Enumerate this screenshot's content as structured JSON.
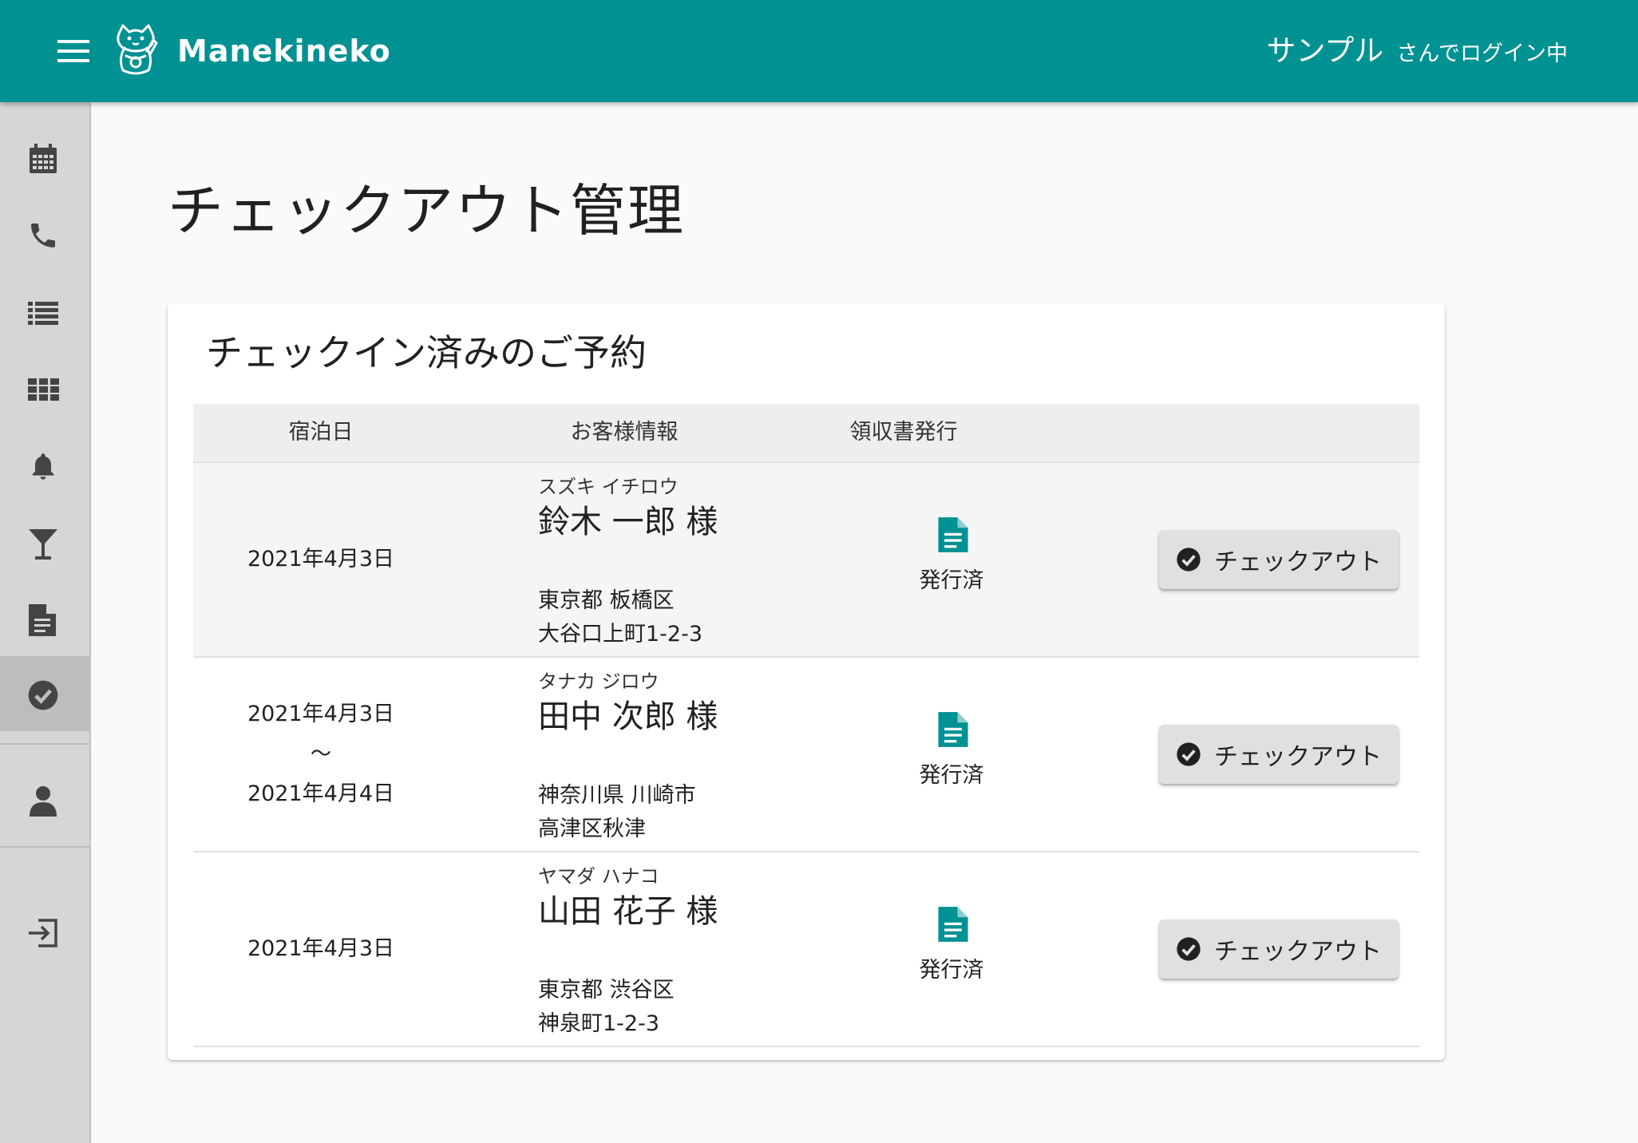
{
  "appbar": {
    "brand": "Manekineko",
    "login_name": "サンプル",
    "login_suffix": "さんでログイン中",
    "color": "#009193"
  },
  "sidebar": {
    "items": [
      {
        "icon": "calendar-icon"
      },
      {
        "icon": "phone-icon"
      },
      {
        "icon": "list-icon"
      },
      {
        "icon": "grid-icon"
      },
      {
        "icon": "bell-icon"
      },
      {
        "icon": "cocktail-icon"
      },
      {
        "icon": "document-icon"
      },
      {
        "icon": "check-circle-icon",
        "active": true
      },
      {
        "icon": "person-icon"
      },
      {
        "icon": "logout-icon"
      }
    ]
  },
  "page": {
    "title": "チェックアウト管理"
  },
  "card": {
    "title": "チェックイン済みのご予約",
    "columns": [
      "宿泊日",
      "お客様情報",
      "領収書発行"
    ],
    "rows": [
      {
        "date_start": "2021年4月3日",
        "kana": "スズキ イチロウ",
        "name": "鈴木 一郎 様",
        "address1": "東京都 板橋区",
        "address2": "大谷口上町1-2-3",
        "receipt_status": "発行済",
        "action_label": "チェックアウト"
      },
      {
        "date_start": "2021年4月3日",
        "date_sep": "〜",
        "date_end": "2021年4月4日",
        "kana": "タナカ ジロウ",
        "name": "田中 次郎 様",
        "address1": "神奈川県 川崎市",
        "address2": "高津区秋津",
        "receipt_status": "発行済",
        "action_label": "チェックアウト"
      },
      {
        "date_start": "2021年4月3日",
        "kana": "ヤマダ ハナコ",
        "name": "山田 花子 様",
        "address1": "東京都 渋谷区",
        "address2": "神泉町1-2-3",
        "receipt_status": "発行済",
        "action_label": "チェックアウト"
      }
    ]
  }
}
